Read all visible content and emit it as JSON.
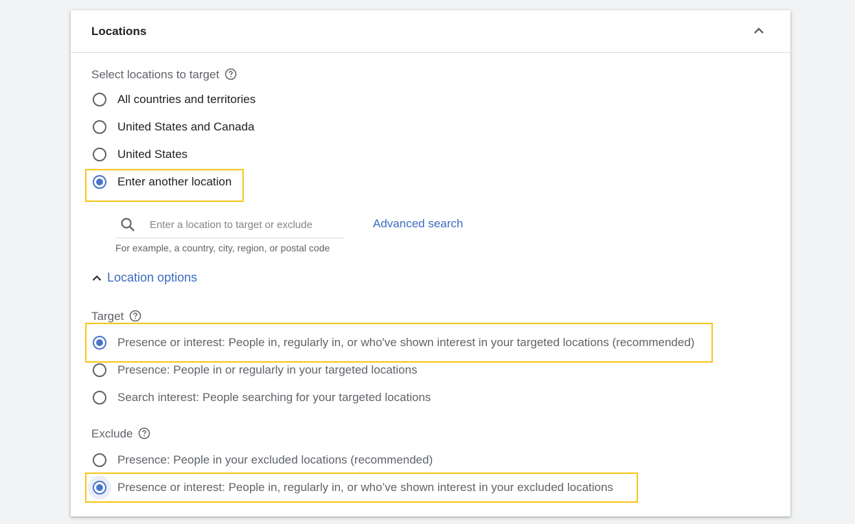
{
  "card": {
    "title": "Locations"
  },
  "select_locations": {
    "label": "Select locations to target",
    "options": [
      {
        "label": "All countries and territories",
        "checked": false
      },
      {
        "label": "United States and Canada",
        "checked": false
      },
      {
        "label": "United States",
        "checked": false
      },
      {
        "label": "Enter another location",
        "checked": true
      }
    ]
  },
  "search": {
    "placeholder": "Enter a location to target or exclude",
    "value": "",
    "hint": "For example, a country, city, region, or postal code",
    "advanced_link": "Advanced search"
  },
  "location_options": {
    "label": "Location options"
  },
  "target": {
    "label": "Target",
    "options": [
      {
        "label": "Presence or interest: People in, regularly in, or who've shown interest in your targeted locations (recommended)",
        "checked": true
      },
      {
        "label": "Presence: People in or regularly in your targeted locations",
        "checked": false
      },
      {
        "label": "Search interest: People searching for your targeted locations",
        "checked": false
      }
    ]
  },
  "exclude": {
    "label": "Exclude",
    "options": [
      {
        "label": "Presence: People in your excluded locations (recommended)",
        "checked": false
      },
      {
        "label": "Presence or interest: People in, regularly in, or who’ve shown interest in your excluded locations",
        "checked": true
      }
    ]
  },
  "colors": {
    "accent": "#4a74c9",
    "link": "#3c6bc1",
    "highlight": "#f9c51a"
  }
}
